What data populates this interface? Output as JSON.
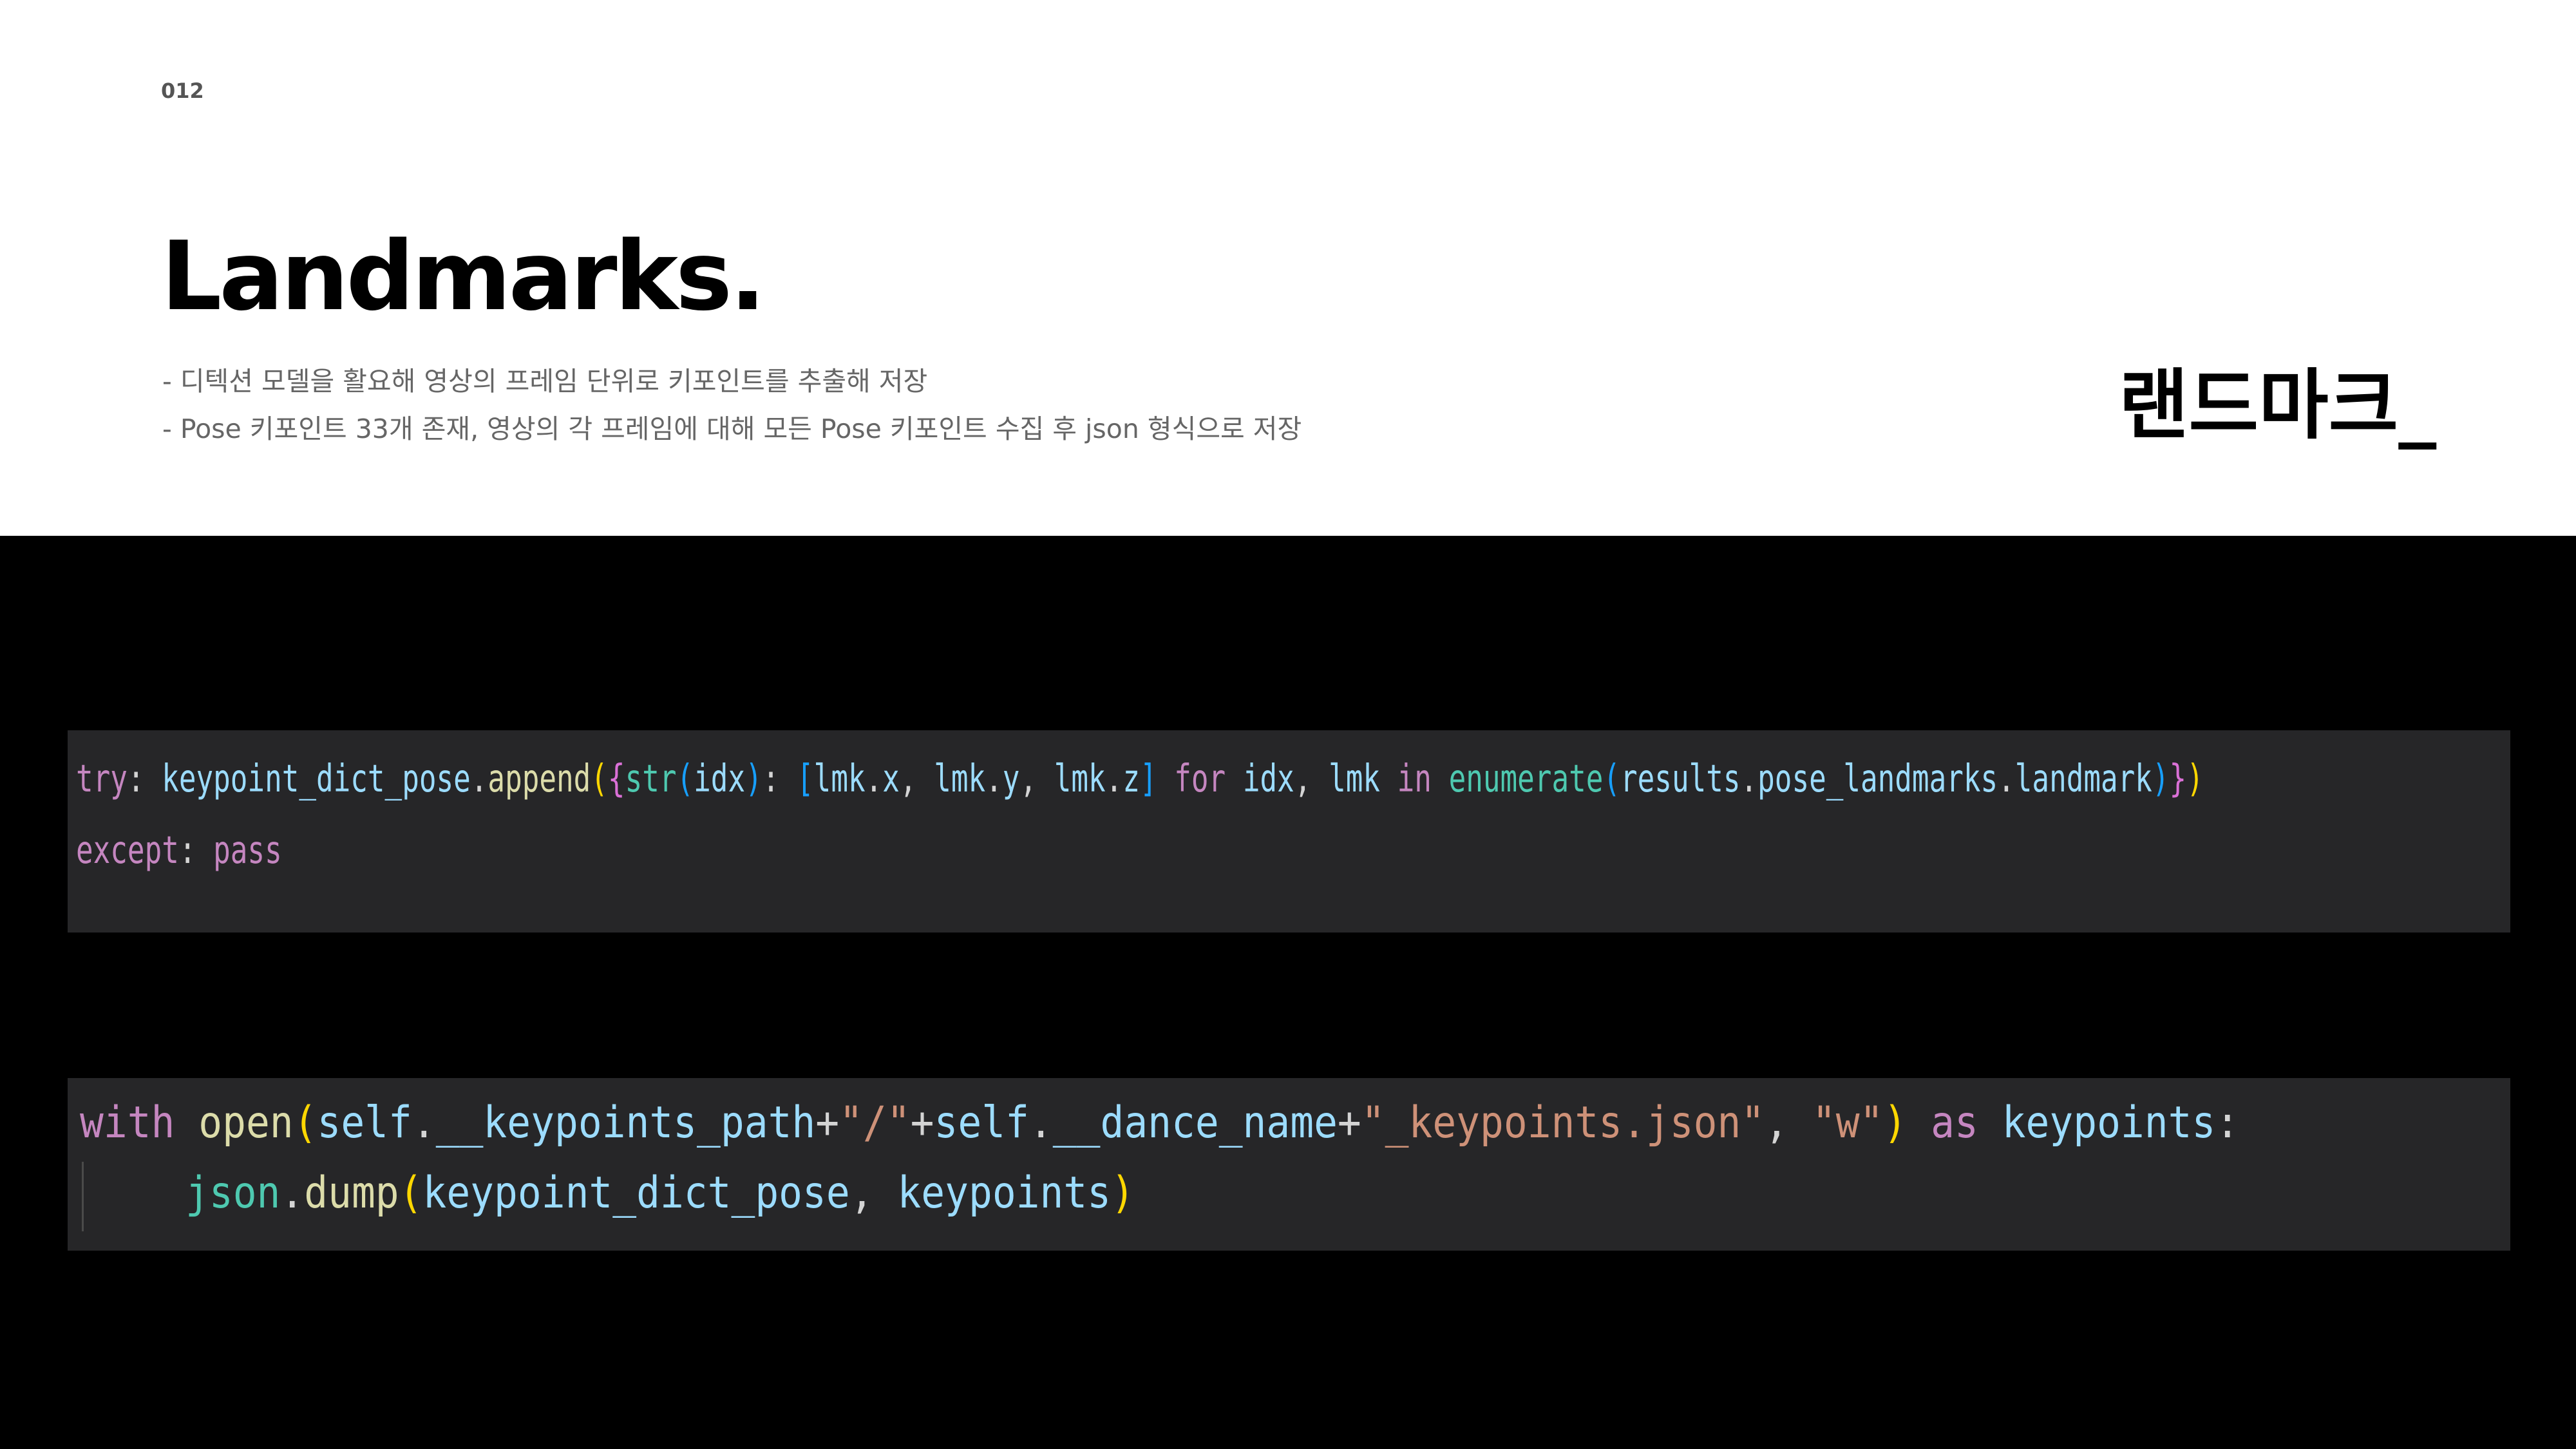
{
  "slide": {
    "page_number": "012",
    "title": "Landmarks.",
    "korean_title": "랜드마크_",
    "bullets": [
      "- 디텍션 모델을 활요해 영상의 프레임 단위로 키포인트를 추출해 저장",
      "- Pose 키포인트 33개 존재, 영상의 각 프레임에 대해 모든 Pose 키포인트 수집 후 json 형식으로 저장"
    ]
  },
  "code_blocks": [
    {
      "lines": [
        "try: keypoint_dict_pose.append({str(idx): [lmk.x, lmk.y, lmk.z] for idx, lmk in enumerate(results.pose_landmarks.landmark)})",
        "except: pass"
      ]
    },
    {
      "lines": [
        "with open(self.__keypoints_path+\"/\"+self.__dance_name+\"_keypoints.json\", \"w\") as keypoints:",
        "json.dump(keypoint_dict_pose, keypoints)"
      ]
    }
  ],
  "colors": {
    "keyword": "#c586c0",
    "function": "#dcdcaa",
    "variable": "#9cdcfe",
    "builtin": "#4ec9b0",
    "string": "#ce9178",
    "code_background": "#262628",
    "section_background": "#000000"
  }
}
